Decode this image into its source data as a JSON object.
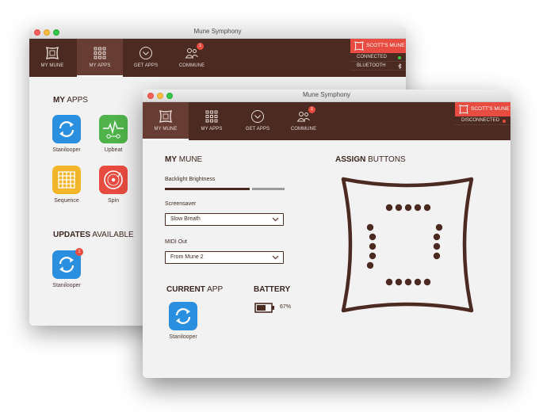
{
  "back_window": {
    "title": "Mune Symphony",
    "nav": [
      {
        "label": "MY MUNE",
        "icon": "mune-device-icon"
      },
      {
        "label": "MY APPS",
        "icon": "apps-grid-icon"
      },
      {
        "label": "GET APPS",
        "icon": "download-icon"
      },
      {
        "label": "COMMUNE",
        "icon": "people-icon",
        "badge": "1"
      }
    ],
    "active_tab": "MY APPS",
    "device": {
      "name": "SCOTT'S MUNE",
      "status": "CONNECTED",
      "bluetooth": "BLUETOOTH"
    },
    "my_apps": {
      "title_bold": "MY",
      "title_rest": "APPS",
      "apps": [
        {
          "label": "Stanilooper",
          "icon": "loop-arrows-icon",
          "color": "#2b8fdf"
        },
        {
          "label": "Upbeat",
          "icon": "heartbeat-icon",
          "color": "#4fb24a"
        },
        {
          "label": "Sequence",
          "icon": "grid-pads-icon",
          "color": "#f5b52b"
        },
        {
          "label": "Spin",
          "icon": "vinyl-icon",
          "color": "#e84b3f"
        }
      ]
    },
    "updates": {
      "title_bold": "UPDATES",
      "title_rest": "AVAILABLE",
      "apps": [
        {
          "label": "Stanilooper",
          "icon": "loop-arrows-icon",
          "color": "#2b8fdf",
          "badge": "1"
        }
      ]
    }
  },
  "front_window": {
    "title": "Mune Symphony",
    "nav": [
      {
        "label": "MY MUNE",
        "icon": "mune-device-icon"
      },
      {
        "label": "MY APPS",
        "icon": "apps-grid-icon"
      },
      {
        "label": "GET APPS",
        "icon": "download-icon"
      },
      {
        "label": "COMMUNE",
        "icon": "people-icon",
        "badge": "1"
      }
    ],
    "active_tab": "MY MUNE",
    "device": {
      "name": "SCOTT'S MUNE",
      "status": "DISCONNECTED"
    },
    "my_mune": {
      "title_bold": "MY",
      "title_rest": "MUNE",
      "backlight_label": "Backlight Brightness",
      "backlight_level": 0.71,
      "screensaver_label": "Screensaver",
      "screensaver_value": "Slow Breath",
      "midi_label": "MIDI Out",
      "midi_value": "From Mune 2"
    },
    "assign": {
      "title_bold": "ASSIGN",
      "title_rest": "BUTTONS"
    },
    "current_app": {
      "title_bold": "CURRENT",
      "title_rest": "APP",
      "app": {
        "label": "Stanilooper",
        "icon": "loop-arrows-icon",
        "color": "#2b8fdf"
      }
    },
    "battery": {
      "title": "BATTERY",
      "percent": "67%",
      "level": 0.67
    }
  },
  "colors": {
    "nav_bg": "#4b2a22",
    "nav_active": "#673d33",
    "accent_red": "#e84b3f",
    "connected_green": "#3fc64a",
    "disconnected_red": "#e84b3f"
  }
}
